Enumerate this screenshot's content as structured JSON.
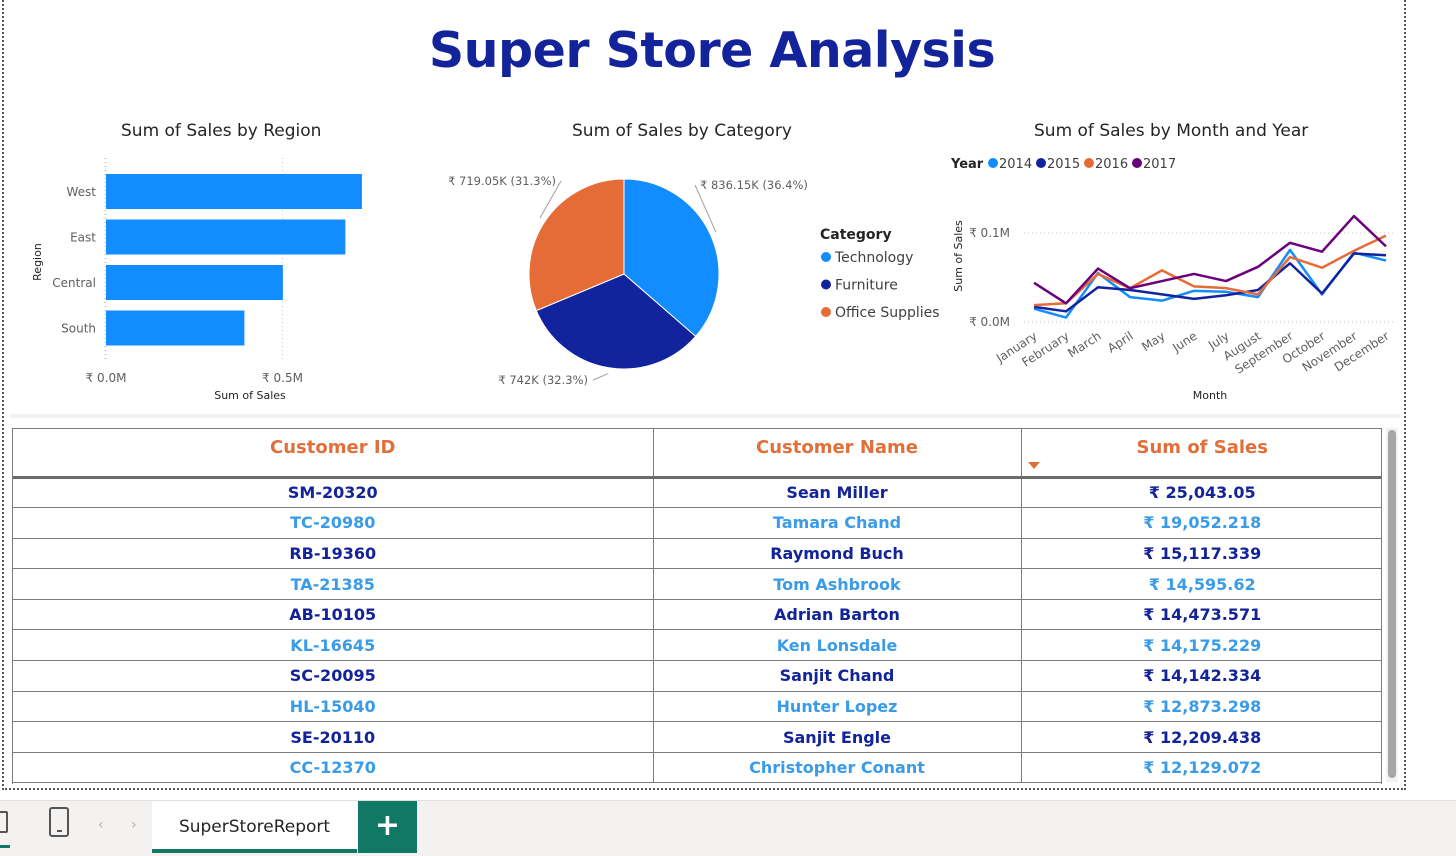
{
  "title": "Super Store Analysis",
  "colors": {
    "title": "#13239a",
    "tech": "#118dff",
    "furniture": "#12239e",
    "office": "#e66c37",
    "y2014": "#118dff",
    "y2015": "#12239e",
    "y2016": "#e66c37",
    "y2017": "#6b007b",
    "header": "#e0703b",
    "row_dark": "#13239a",
    "row_light": "#3a9be8",
    "tab_accent": "#117865"
  },
  "chart_data": [
    {
      "type": "bar",
      "title": "Sum of Sales by Region",
      "orientation": "horizontal",
      "categories": [
        "West",
        "East",
        "Central",
        "South"
      ],
      "values": [
        725000,
        678000,
        501000,
        392000
      ],
      "xlabel": "Sum of Sales",
      "ylabel": "Region",
      "xticks": [
        "₹ 0.0M",
        "₹ 0.5M"
      ],
      "xlim": [
        0,
        800000
      ],
      "grid": true
    },
    {
      "type": "pie",
      "title": "Sum of Sales by Category",
      "categories": [
        "Technology",
        "Furniture",
        "Office Supplies"
      ],
      "values": [
        836150,
        742000,
        719050
      ],
      "labels": [
        "₹ 836.15K (36.4%)",
        "₹ 742K (32.3%)",
        "₹ 719.05K (31.3%)"
      ],
      "legend_title": "Category",
      "legend": "right"
    },
    {
      "type": "line",
      "title": "Sum of Sales by Month and Year",
      "xlabel": "Month",
      "ylabel": "Sum of Sales",
      "legend_title": "Year",
      "legend": "top-left",
      "x": [
        "January",
        "February",
        "March",
        "April",
        "May",
        "June",
        "July",
        "August",
        "September",
        "October",
        "November",
        "December"
      ],
      "yticks": [
        "₹ 0.0M",
        "₹ 0.1M"
      ],
      "ylim": [
        0,
        0.1
      ],
      "series": [
        {
          "name": "2014",
          "values": [
            0.015,
            0.005,
            0.055,
            0.028,
            0.024,
            0.035,
            0.034,
            0.028,
            0.081,
            0.031,
            0.078,
            0.069
          ]
        },
        {
          "name": "2015",
          "values": [
            0.017,
            0.012,
            0.039,
            0.036,
            0.031,
            0.026,
            0.03,
            0.036,
            0.066,
            0.032,
            0.077,
            0.075
          ]
        },
        {
          "name": "2016",
          "values": [
            0.019,
            0.021,
            0.054,
            0.038,
            0.058,
            0.04,
            0.038,
            0.031,
            0.073,
            0.061,
            0.08,
            0.097
          ]
        },
        {
          "name": "2017",
          "values": [
            0.044,
            0.021,
            0.06,
            0.038,
            0.046,
            0.054,
            0.046,
            0.062,
            0.089,
            0.079,
            0.119,
            0.085
          ]
        }
      ]
    }
  ],
  "table": {
    "headers": [
      "Customer ID",
      "Customer Name",
      "Sum of Sales"
    ],
    "rows": [
      [
        "SM-20320",
        "Sean Miller",
        "₹ 25,043.05"
      ],
      [
        "TC-20980",
        "Tamara Chand",
        "₹ 19,052.218"
      ],
      [
        "RB-19360",
        "Raymond Buch",
        "₹ 15,117.339"
      ],
      [
        "TA-21385",
        "Tom Ashbrook",
        "₹ 14,595.62"
      ],
      [
        "AB-10105",
        "Adrian Barton",
        "₹ 14,473.571"
      ],
      [
        "KL-16645",
        "Ken Lonsdale",
        "₹ 14,175.229"
      ],
      [
        "SC-20095",
        "Sanjit Chand",
        "₹ 14,142.334"
      ],
      [
        "HL-15040",
        "Hunter Lopez",
        "₹ 12,873.298"
      ],
      [
        "SE-20110",
        "Sanjit Engle",
        "₹ 12,209.438"
      ],
      [
        "CC-12370",
        "Christopher Conant",
        "₹ 12,129.072"
      ]
    ]
  },
  "tabs": {
    "page_label": "SuperStoreReport",
    "add_label": "+"
  }
}
